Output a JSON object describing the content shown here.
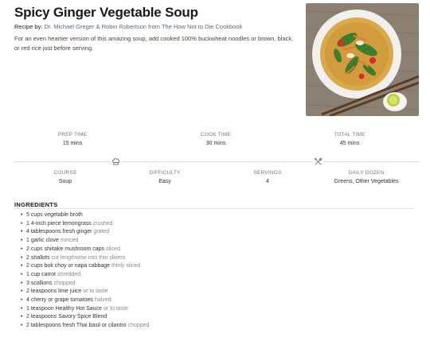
{
  "recipe": {
    "title": "Spicy Ginger Vegetable Soup",
    "byline_label": "Recipe by:",
    "byline_authors": "Dr. Michael Greger & Robin Robertson from The How Not to Die Cookbook",
    "description": "For an even heartier version of this amazing soup, add cooked 100% buckwheat noodles or brown, black, or red rice just before serving."
  },
  "times": [
    {
      "label": "PREP TIME",
      "value": "15 mins"
    },
    {
      "label": "COOK TIME",
      "value": "30 mins"
    },
    {
      "label": "TOTAL TIME",
      "value": "45 mins"
    }
  ],
  "meta": [
    {
      "label": "COURSE",
      "value": "Soup"
    },
    {
      "label": "DIFFICULTY",
      "value": "Easy"
    },
    {
      "label": "SERVINGS",
      "value": "4"
    },
    {
      "label": "DAILY DOZEN",
      "value": "Greens, Other Vegetables"
    }
  ],
  "icons": {
    "left": "chef-hat-icon",
    "right": "utensils-icon",
    "bullet": "•"
  },
  "ingredients_heading": "INGREDIENTS",
  "ingredients": [
    {
      "text": "5 cups vegetable broth",
      "note": ""
    },
    {
      "text": "1 4-inch piece lemongrass",
      "note": "crushed"
    },
    {
      "text": "4 tablespoons fresh ginger",
      "note": "grated"
    },
    {
      "text": "1 garlic clove",
      "note": "minced"
    },
    {
      "text": "2 cups shiitake mushroom caps",
      "note": "sliced"
    },
    {
      "text": "2 shallots",
      "note": "cut lengthwise into thin slivers"
    },
    {
      "text": "2 cups bok choy or napa cabbage",
      "note": "thinly sliced"
    },
    {
      "text": "1 cup carrot",
      "note": "shredded"
    },
    {
      "text": "3 scallions",
      "note": "chopped"
    },
    {
      "text": "2 teaspoons lime juice",
      "note": "or to taste"
    },
    {
      "text": "4 cherry or grape tomatoes",
      "note": "halved"
    },
    {
      "text": "1 teaspoon Healthy Hot Sauce",
      "note": "or to taste"
    },
    {
      "text": "2 teaspoons Savory Spice Blend",
      "note": ""
    },
    {
      "text": "2 tablespoons fresh Thai basil or cilantro",
      "note": "chopped"
    }
  ]
}
